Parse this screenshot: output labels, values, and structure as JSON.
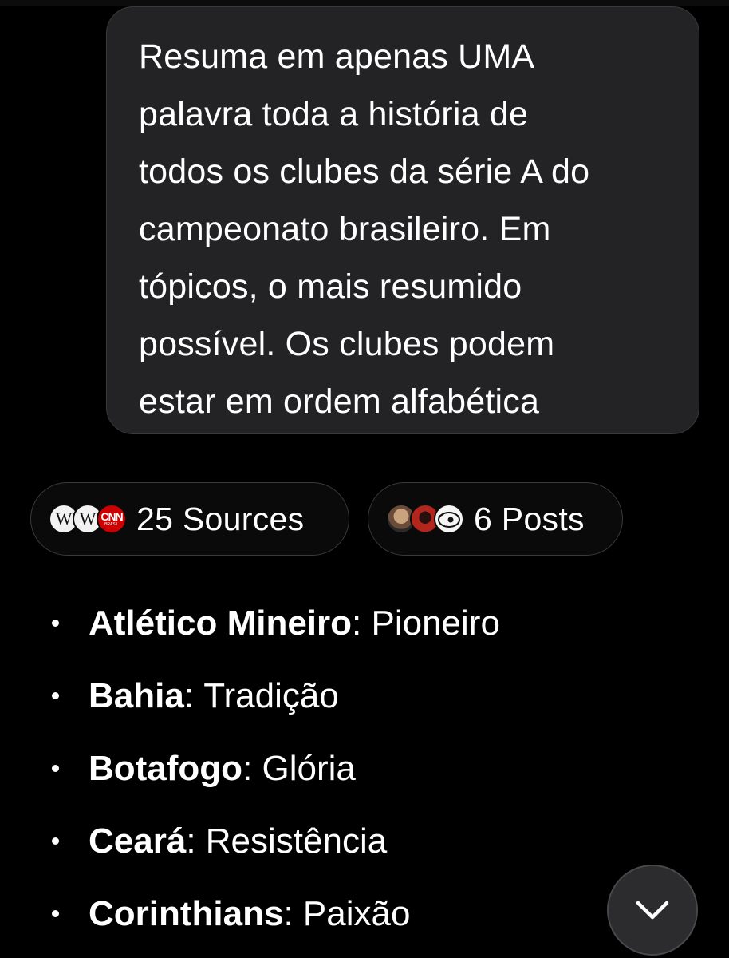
{
  "prompt": {
    "text": "Resuma em apenas UMA\npalavra toda a história de\ntodos os clubes da série A do\ncampeonato brasileiro. Em\ntópicos, o mais resumido\npossível. Os clubes podem\nestar em ordem alfabética"
  },
  "chips": {
    "sources": {
      "label": "25 Sources",
      "icons": [
        "wikipedia-icon",
        "wikipedia-icon",
        "cnn-brasil-icon"
      ],
      "wiki_glyph": "W",
      "cnn_main": "CNN",
      "cnn_sub": "BRASIL"
    },
    "posts": {
      "label": "6 Posts",
      "icons": [
        "user-avatar",
        "user-avatar",
        "user-avatar"
      ]
    }
  },
  "answer": {
    "items": [
      {
        "club": "Atlético Mineiro",
        "sep": ": ",
        "word": "Pioneiro"
      },
      {
        "club": "Bahia",
        "sep": ": ",
        "word": "Tradição"
      },
      {
        "club": "Botafogo",
        "sep": ": ",
        "word": "Glória"
      },
      {
        "club": "Ceará",
        "sep": ": ",
        "word": "Resistência"
      },
      {
        "club": "Corinthians",
        "sep": ": ",
        "word": "Paixão"
      }
    ]
  },
  "colors": {
    "background": "#000000",
    "bubble": "#232325",
    "chip_border": "#3a3a3d",
    "text": "#ffffff",
    "cnn_red": "#cc0000"
  },
  "scroll_button": {
    "icon": "chevron-down-icon"
  }
}
